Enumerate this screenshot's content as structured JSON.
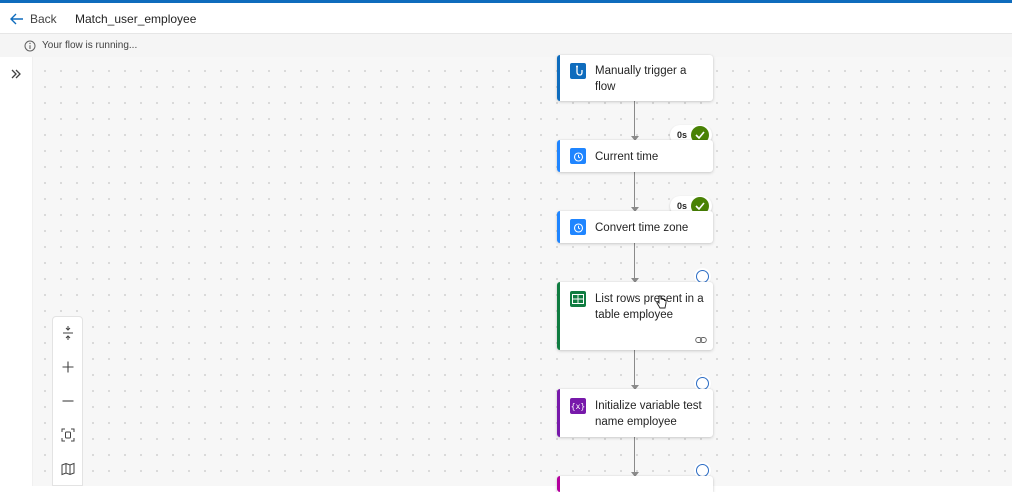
{
  "header": {
    "back_label": "Back",
    "flow_title": "Match_user_employee"
  },
  "status": {
    "message": "Your flow is running..."
  },
  "steps": [
    {
      "label": "Manually trigger a flow",
      "icon": "hand-touch-icon",
      "accent": "#0f6cbd",
      "icon_bg": "#0f6cbd",
      "state": "succeeded"
    },
    {
      "label": "Current time",
      "icon": "clock-icon",
      "accent": "#1f85ff",
      "icon_bg": "#1f85ff",
      "duration": "0s",
      "state": "succeeded"
    },
    {
      "label": "Convert time zone",
      "icon": "clock-icon",
      "accent": "#1f85ff",
      "icon_bg": "#1f85ff",
      "duration": "0s",
      "state": "succeeded"
    },
    {
      "label": "List rows present in a table employee",
      "icon": "excel-icon",
      "accent": "#107c41",
      "icon_bg": "#107c41",
      "state": "running"
    },
    {
      "label": "Initialize variable test name employee",
      "icon": "variable-icon",
      "accent": "#7719aa",
      "icon_bg": "#7719aa",
      "state": "running"
    }
  ],
  "colors": {
    "brand": "#0f6cbd",
    "success": "#498205",
    "canvas_bg": "#f7f7f7"
  },
  "zoom_tools": [
    "fit-vertical-icon",
    "zoom-in-icon",
    "zoom-out-icon",
    "fit-view-icon",
    "minimap-icon"
  ]
}
